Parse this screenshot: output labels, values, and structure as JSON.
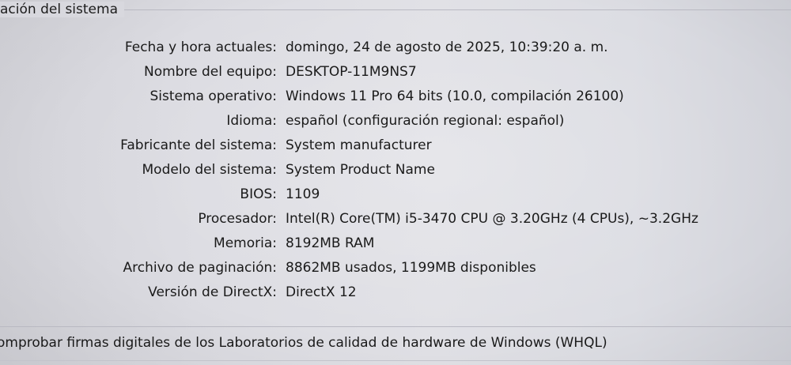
{
  "section": {
    "title": "ación del sistema"
  },
  "system_info": [
    {
      "label": "Fecha y hora actuales:",
      "value": "domingo, 24 de agosto de 2025, 10:39:20 a. m."
    },
    {
      "label": "Nombre del equipo:",
      "value": "DESKTOP-11M9NS7"
    },
    {
      "label": "Sistema operativo:",
      "value": "Windows 11 Pro 64 bits (10.0, compilación 26100)"
    },
    {
      "label": "Idioma:",
      "value": "español (configuración regional: español)"
    },
    {
      "label": "Fabricante del sistema:",
      "value": "System manufacturer"
    },
    {
      "label": "Modelo del sistema:",
      "value": "System Product Name"
    },
    {
      "label": "BIOS:",
      "value": "1109"
    },
    {
      "label": "Procesador:",
      "value": "Intel(R) Core(TM) i5-3470 CPU @ 3.20GHz (4 CPUs), ~3.2GHz"
    },
    {
      "label": "Memoria:",
      "value": "8192MB RAM"
    },
    {
      "label": "Archivo de paginación:",
      "value": "8862MB usados, 1199MB disponibles"
    },
    {
      "label": "Versión de DirectX:",
      "value": "DirectX 12"
    }
  ],
  "whql": {
    "label": "omprobar firmas digitales de los Laboratorios de calidad de hardware de Windows (WHQL)"
  }
}
